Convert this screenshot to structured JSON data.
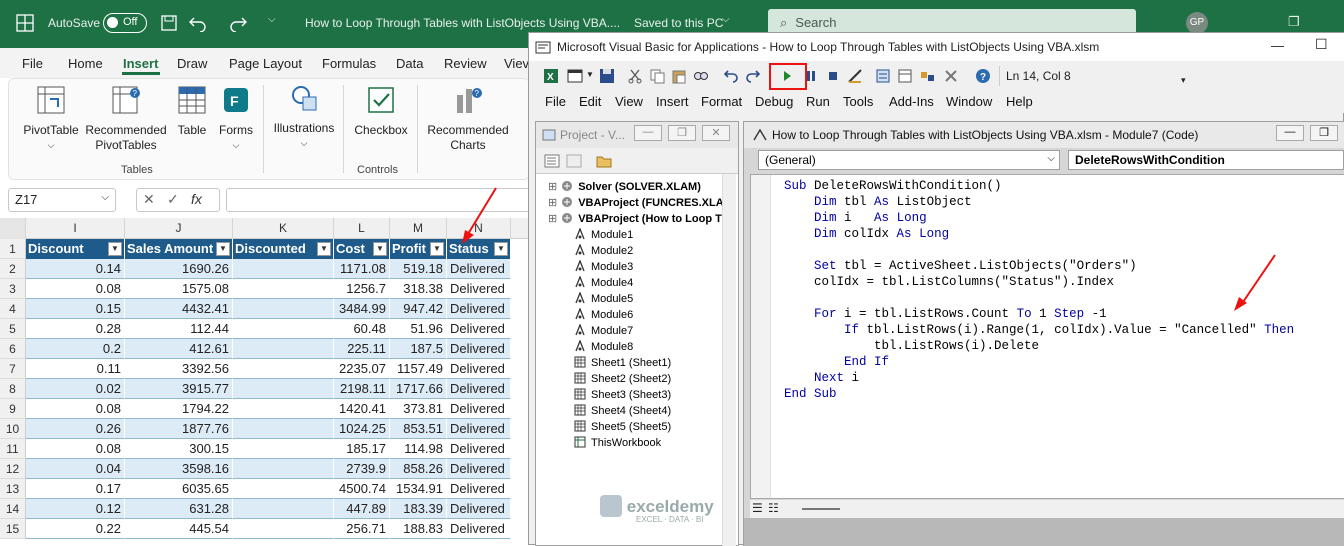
{
  "excel": {
    "autosave_label": "AutoSave",
    "autosave_state": "Off",
    "title": "How to Loop Through Tables with ListObjects Using VBA....",
    "saved_state": "Saved to this PC",
    "search_placeholder": "Search",
    "avatar_initials": "GP",
    "tabs": [
      "File",
      "Home",
      "Insert",
      "Draw",
      "Page Layout",
      "Formulas",
      "Data",
      "Review",
      "Viev"
    ],
    "ribbon": {
      "pivottable": "PivotTable",
      "recommended_pivot_1": "Recommended",
      "recommended_pivot_2": "PivotTables",
      "table": "Table",
      "forms": "Forms",
      "illustrations": "Illustrations",
      "checkbox": "Checkbox",
      "recommended_charts_1": "Recommended",
      "recommended_charts_2": "Charts",
      "group_tables": "Tables",
      "group_controls": "Controls"
    },
    "name_box": "Z17",
    "fx": "fx",
    "columns": [
      "I",
      "J",
      "K",
      "L",
      "M",
      "N"
    ],
    "headers": [
      "Discount",
      "Sales Amount",
      "Discounted",
      "Cost",
      "Profit",
      "Status"
    ],
    "rows": [
      {
        "n": "1"
      },
      {
        "n": "2",
        "i": "0.14",
        "j": "1690.26",
        "l": "1171.08",
        "m": "519.18",
        "s": "Delivered"
      },
      {
        "n": "3",
        "i": "0.08",
        "j": "1575.08",
        "l": "1256.7",
        "m": "318.38",
        "s": "Delivered"
      },
      {
        "n": "4",
        "i": "0.15",
        "j": "4432.41",
        "l": "3484.99",
        "m": "947.42",
        "s": "Delivered"
      },
      {
        "n": "5",
        "i": "0.28",
        "j": "112.44",
        "l": "60.48",
        "m": "51.96",
        "s": "Delivered"
      },
      {
        "n": "6",
        "i": "0.2",
        "j": "412.61",
        "l": "225.11",
        "m": "187.5",
        "s": "Delivered"
      },
      {
        "n": "7",
        "i": "0.11",
        "j": "3392.56",
        "l": "2235.07",
        "m": "1157.49",
        "s": "Delivered"
      },
      {
        "n": "8",
        "i": "0.02",
        "j": "3915.77",
        "l": "2198.11",
        "m": "1717.66",
        "s": "Delivered"
      },
      {
        "n": "9",
        "i": "0.08",
        "j": "1794.22",
        "l": "1420.41",
        "m": "373.81",
        "s": "Delivered"
      },
      {
        "n": "10",
        "i": "0.26",
        "j": "1877.76",
        "l": "1024.25",
        "m": "853.51",
        "s": "Delivered"
      },
      {
        "n": "11",
        "i": "0.08",
        "j": "300.15",
        "l": "185.17",
        "m": "114.98",
        "s": "Delivered"
      },
      {
        "n": "12",
        "i": "0.04",
        "j": "3598.16",
        "l": "2739.9",
        "m": "858.26",
        "s": "Delivered"
      },
      {
        "n": "13",
        "i": "0.17",
        "j": "6035.65",
        "l": "4500.74",
        "m": "1534.91",
        "s": "Delivered"
      },
      {
        "n": "14",
        "i": "0.12",
        "j": "631.28",
        "l": "447.89",
        "m": "183.39",
        "s": "Delivered"
      },
      {
        "n": "15",
        "i": "0.22",
        "j": "445.54",
        "l": "256.71",
        "m": "188.83",
        "s": "Delivered"
      }
    ]
  },
  "vbe": {
    "title": "Microsoft Visual Basic for Applications - How to Loop Through Tables with ListObjects Using VBA.xlsm",
    "position": "Ln 14, Col 8",
    "menu": [
      "File",
      "Edit",
      "View",
      "Insert",
      "Format",
      "Debug",
      "Run",
      "Tools",
      "Add-Ins",
      "Window",
      "Help"
    ],
    "project_title": "Project - V...",
    "tree": [
      {
        "label": "Solver (SOLVER.XLAM)",
        "bold": true,
        "level": 0
      },
      {
        "label": "VBAProject (FUNCRES.XLAM",
        "bold": true,
        "level": 0
      },
      {
        "label": "VBAProject (How to Loop T",
        "bold": true,
        "level": 0
      },
      {
        "label": "Module1",
        "level": 1
      },
      {
        "label": "Module2",
        "level": 1
      },
      {
        "label": "Module3",
        "level": 1
      },
      {
        "label": "Module4",
        "level": 1
      },
      {
        "label": "Module5",
        "level": 1
      },
      {
        "label": "Module6",
        "level": 1
      },
      {
        "label": "Module7",
        "level": 1
      },
      {
        "label": "Module8",
        "level": 1
      },
      {
        "label": "Sheet1 (Sheet1)",
        "level": 1
      },
      {
        "label": "Sheet2 (Sheet2)",
        "level": 1
      },
      {
        "label": "Sheet3 (Sheet3)",
        "level": 1
      },
      {
        "label": "Sheet4 (Sheet4)",
        "level": 1
      },
      {
        "label": "Sheet5 (Sheet5)",
        "level": 1
      },
      {
        "label": "ThisWorkbook",
        "level": 1
      }
    ],
    "code_title": "How to Loop Through Tables with ListObjects Using VBA.xlsm - Module7 (Code)",
    "object_combo": "(General)",
    "proc_combo": "DeleteRowsWithCondition",
    "code": [
      "Sub DeleteRowsWithCondition()",
      "    Dim tbl As ListObject",
      "    Dim i   As Long",
      "    Dim colIdx As Long",
      "",
      "    Set tbl = ActiveSheet.ListObjects(\"Orders\")",
      "    colIdx = tbl.ListColumns(\"Status\").Index",
      "",
      "    For i = tbl.ListRows.Count To 1 Step -1",
      "        If tbl.ListRows(i).Range(1, colIdx).Value = \"Cancelled\" Then",
      "            tbl.ListRows(i).Delete",
      "        End If",
      "    Next i",
      "End Sub"
    ],
    "watermark_name": "exceldemy",
    "watermark_tag": "EXCEL · DATA · BI"
  },
  "colors": {
    "excel_green": "#1e7145",
    "table_header": "#1f5b8a",
    "band": "#ddebf7",
    "keyword": "#0000a0",
    "annotation": "#e11111"
  }
}
